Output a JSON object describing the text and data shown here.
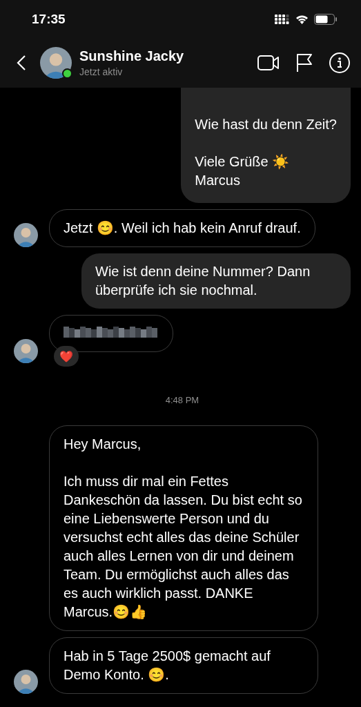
{
  "status_bar": {
    "time": "17:35"
  },
  "header": {
    "name": "Sunshine Jacky",
    "status": "Jetzt aktiv",
    "online": true
  },
  "messages": [
    {
      "kind": "outgoing",
      "text": "Wie hast du denn Zeit?\n\nViele Grüße ☀️\nMarcus",
      "cut_top": true
    },
    {
      "kind": "incoming",
      "text": "Jetzt 😊. Weil ich hab kein Anruf drauf.",
      "show_avatar": true
    },
    {
      "kind": "outgoing",
      "text": "Wie ist denn deine Nummer? Dann überprüfe ich sie nochmal."
    },
    {
      "kind": "redacted",
      "show_avatar": true,
      "reaction": "❤️"
    },
    {
      "kind": "timestamp",
      "text": "4:48 PM"
    },
    {
      "kind": "incoming",
      "text": "Hey Marcus,\n\nIch muss dir mal ein Fettes Dankeschön da lassen. Du bist echt so eine Liebenswerte Person und du versuchst echt alles das deine Schüler auch alles Lernen von dir und deinem Team. Du ermöglichst auch alles das es auch wirklich passt. DANKE Marcus.😊👍",
      "show_avatar": false
    },
    {
      "kind": "incoming",
      "text": "Hab in 5 Tage 2500$ gemacht auf Demo Konto. 😊.",
      "show_avatar": true
    }
  ]
}
